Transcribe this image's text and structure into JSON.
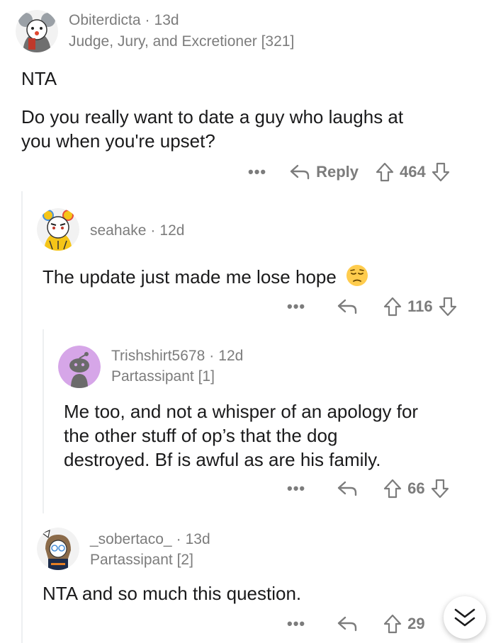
{
  "comments": [
    {
      "author": "Obiterdicta",
      "age": "13d",
      "flair": "Judge, Jury, and Excretioner [321]",
      "body_lines": [
        "NTA",
        "",
        "Do you really want to date a guy who laughs at",
        "you when you're upset?"
      ],
      "more": "•••",
      "reply_label": "Reply",
      "score": "464"
    },
    {
      "author": "seahake",
      "age": "12d",
      "body": "The update just made me lose hope",
      "emoji": "😔",
      "more": "•••",
      "score": "116"
    },
    {
      "author": "Trishshirt5678",
      "age": "12d",
      "flair": "Partassipant [1]",
      "body_lines": [
        "Me too, and not a whisper of an apology for",
        "the other stuff of op’s that the dog",
        "destroyed. Bf is awful as are his family."
      ],
      "more": "•••",
      "score": "66"
    },
    {
      "author": "_sobertaco_",
      "age": "13d",
      "flair": "Partassipant [2]",
      "body": "NTA and so much this question.",
      "more": "•••",
      "score": "29"
    }
  ],
  "separator": "·",
  "colors": {
    "text": "#1a1a1b",
    "meta": "#7c7c7c",
    "thread_line": "#edeff1"
  },
  "icons": {
    "reply": "reply-arrow-icon",
    "upvote": "upvote-arrow-icon",
    "downvote": "downvote-arrow-icon",
    "collapse": "chevron-double-down-icon"
  }
}
